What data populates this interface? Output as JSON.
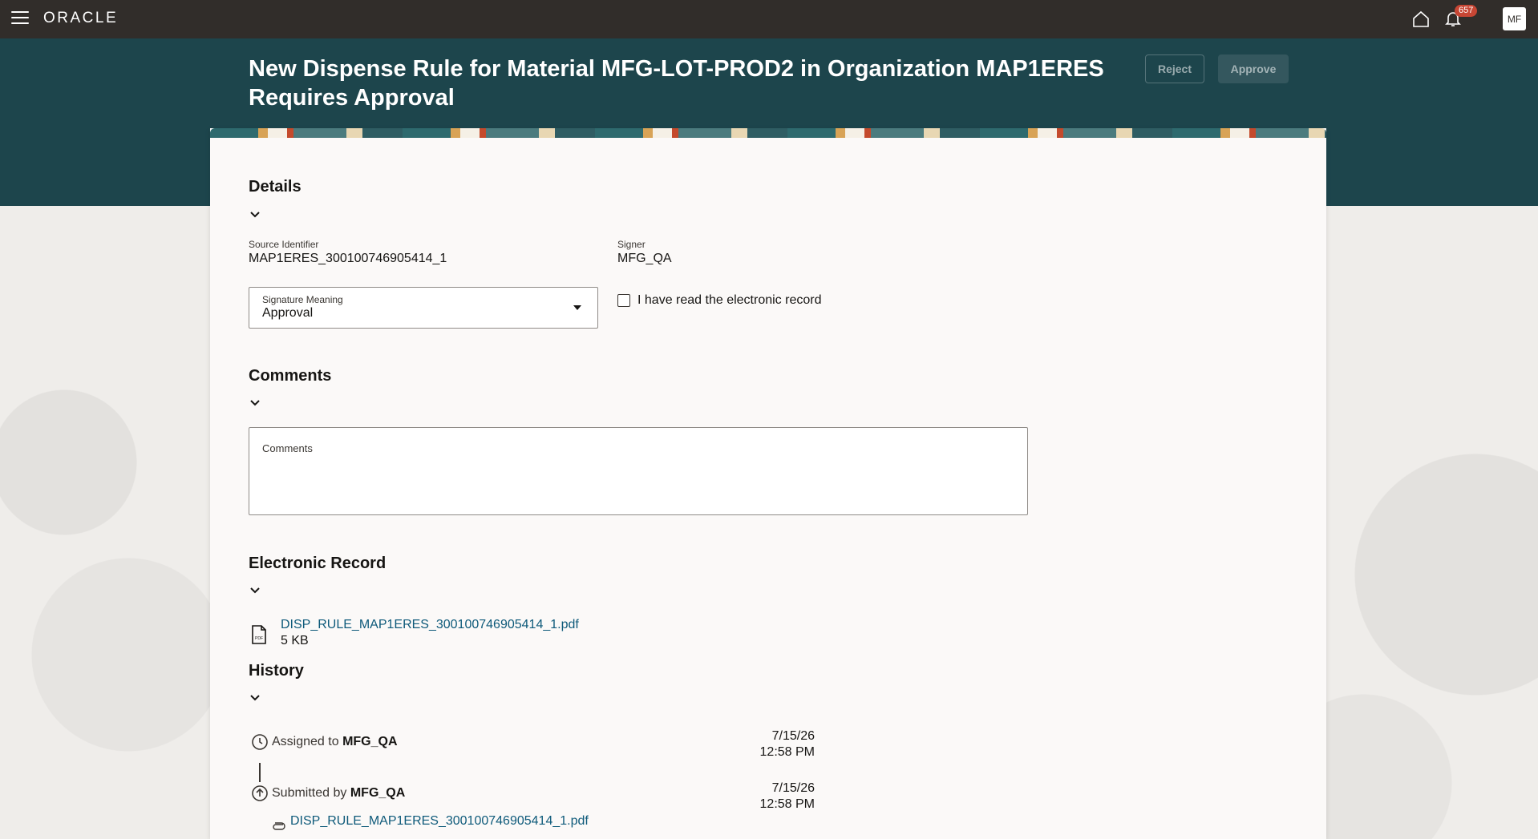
{
  "header": {
    "brand": "ORACLE",
    "notification_count": "657",
    "avatar_initials": "MF"
  },
  "page": {
    "title": "New Dispense Rule for Material MFG-LOT-PROD2 in Organization MAP1ERES Requires Approval",
    "reject_label": "Reject",
    "approve_label": "Approve"
  },
  "details": {
    "title": "Details",
    "source_identifier_label": "Source Identifier",
    "source_identifier_value": "MAP1ERES_300100746905414_1",
    "signer_label": "Signer",
    "signer_value": "MFG_QA",
    "signature_meaning_label": "Signature Meaning",
    "signature_meaning_value": "Approval",
    "read_record_label": "I have read the electronic record"
  },
  "comments": {
    "title": "Comments",
    "field_label": "Comments"
  },
  "electronic_record": {
    "title": "Electronic Record",
    "file_name": "DISP_RULE_MAP1ERES_300100746905414_1.pdf",
    "file_size": "5 KB"
  },
  "history": {
    "title": "History",
    "items": [
      {
        "action": "Assigned to",
        "user": "MFG_QA",
        "date": "7/15/26",
        "time": "12:58 PM"
      },
      {
        "action": "Submitted by",
        "user": "MFG_QA",
        "date": "7/15/26",
        "time": "12:58 PM",
        "attachment": "DISP_RULE_MAP1ERES_300100746905414_1.pdf"
      }
    ]
  },
  "colors": {
    "topbar": "#312d2a",
    "band": "#1d454c",
    "link": "#0e5a7a",
    "badge": "#c74634"
  }
}
